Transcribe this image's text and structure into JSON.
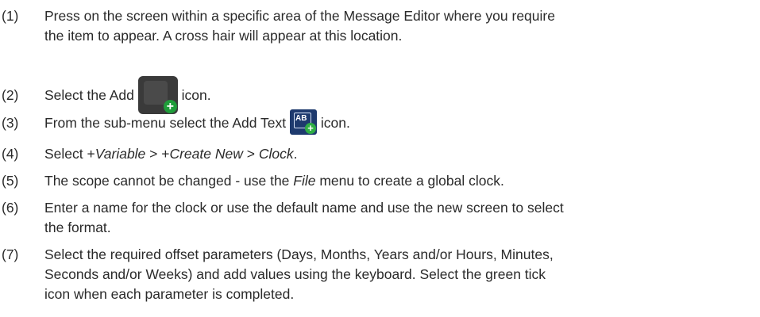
{
  "steps": [
    {
      "num": "(1)",
      "line1": "Press on the screen within a specific area of the Message Editor where you require",
      "line2": "the item to appear. A cross hair will appear at this location."
    },
    {
      "num": "(2)",
      "before": "Select the Add",
      "after": "icon.",
      "icon": "add-icon"
    },
    {
      "num": "(3)",
      "before": "From the sub-menu select the Add Text",
      "after": "icon.",
      "icon": "add-text-icon",
      "icon_text": "AB"
    },
    {
      "num": "(4)",
      "a": "Select +",
      "b": "Variable",
      "c": " > +",
      "d": "Create New",
      "e": " > ",
      "f": "Clock",
      "g": "."
    },
    {
      "num": "(5)",
      "a": "The scope cannot be changed - use the ",
      "b": "File",
      "c": " menu to create a global clock."
    },
    {
      "num": "(6)",
      "line1": "Enter a name for the clock or use the default name and use the new screen to select",
      "line2": "the format."
    },
    {
      "num": "(7)",
      "line1": "Select the required offset parameters (Days, Months, Years and/or Hours, Minutes,",
      "line2": "Seconds and/or Weeks) and add values using the keyboard. Select the green tick",
      "line3": "icon when each parameter is completed."
    }
  ],
  "colors": {
    "text": "#2a2a2a",
    "add_icon_bg": "#3a3a3a",
    "text_icon_bg": "#1e3a6e",
    "plus_green": "#1f9d3a"
  }
}
